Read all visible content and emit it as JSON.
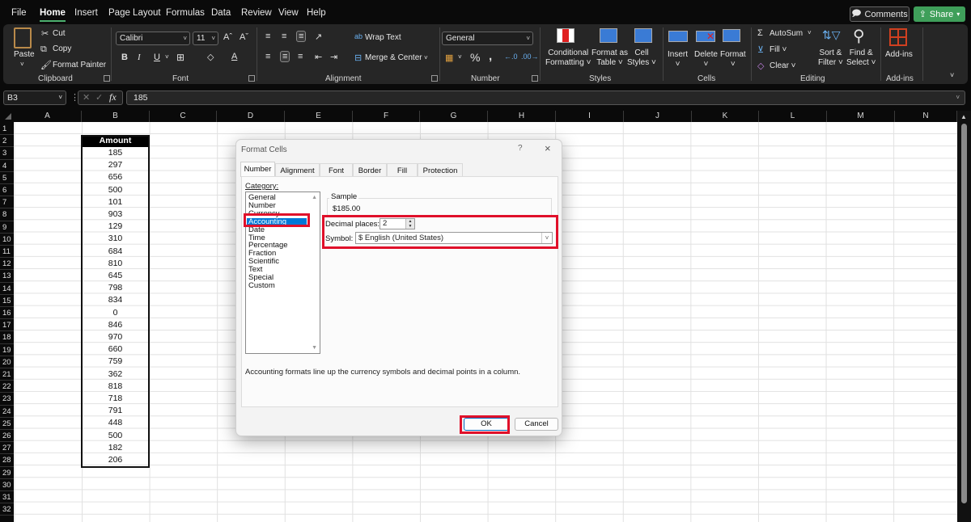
{
  "menu": {
    "items": [
      "File",
      "Home",
      "Insert",
      "Page Layout",
      "Formulas",
      "Data",
      "Review",
      "View",
      "Help"
    ],
    "active": "Home",
    "comments_label": "Comments",
    "share_label": "Share"
  },
  "ribbon": {
    "clipboard": {
      "paste": "Paste",
      "cut": "Cut",
      "copy": "Copy",
      "format_painter": "Format Painter",
      "label": "Clipboard"
    },
    "font": {
      "name": "Calibri",
      "size": "11",
      "bold": "B",
      "italic": "I",
      "underline": "U",
      "label": "Font"
    },
    "alignment": {
      "wrap_text": "Wrap Text",
      "merge_center": "Merge & Center",
      "label": "Alignment"
    },
    "number": {
      "format": "General",
      "percent": "%",
      "comma": ",",
      "label": "Number"
    },
    "styles": {
      "conditional": "Conditional",
      "conditional2": "Formatting",
      "format_table": "Format as",
      "format_table2": "Table",
      "cell_styles": "Cell",
      "cell_styles2": "Styles",
      "label": "Styles"
    },
    "cells": {
      "insert": "Insert",
      "delete": "Delete",
      "format": "Format",
      "label": "Cells"
    },
    "editing": {
      "autosum": "AutoSum",
      "fill": "Fill",
      "clear": "Clear",
      "sort": "Sort &",
      "sort2": "Filter",
      "find": "Find &",
      "find2": "Select",
      "label": "Editing"
    },
    "addins": {
      "button": "Add-ins",
      "label": "Add-ins"
    }
  },
  "formula_bar": {
    "name_box": "B3",
    "fx": "fx",
    "content": "185"
  },
  "columns": [
    "A",
    "B",
    "C",
    "D",
    "E",
    "F",
    "G",
    "H",
    "I",
    "J",
    "K",
    "L",
    "M",
    "N"
  ],
  "rows": [
    "1",
    "2",
    "3",
    "4",
    "5",
    "6",
    "7",
    "8",
    "9",
    "10",
    "11",
    "12",
    "13",
    "14",
    "15",
    "16",
    "17",
    "18",
    "19",
    "20",
    "21",
    "22",
    "23",
    "24",
    "25",
    "26",
    "27",
    "28",
    "29",
    "30",
    "31",
    "32"
  ],
  "table": {
    "header": "Amount",
    "values": [
      "185",
      "297",
      "656",
      "500",
      "101",
      "903",
      "129",
      "310",
      "684",
      "810",
      "645",
      "798",
      "834",
      "0",
      "846",
      "970",
      "660",
      "759",
      "362",
      "818",
      "718",
      "791",
      "448",
      "500",
      "182",
      "206"
    ]
  },
  "dialog": {
    "title": "Format Cells",
    "help": "?",
    "close": "×",
    "tabs": [
      "Number",
      "Alignment",
      "Font",
      "Border",
      "Fill",
      "Protection"
    ],
    "active_tab": "Number",
    "category_label": "Category:",
    "categories": [
      "General",
      "Number",
      "Currency",
      "Accounting",
      "Date",
      "Time",
      "Percentage",
      "Fraction",
      "Scientific",
      "Text",
      "Special",
      "Custom"
    ],
    "selected_category": "Accounting",
    "sample_label": "Sample",
    "sample_value": "$185.00",
    "decimal_label": "Decimal places:",
    "decimal_value": "2",
    "symbol_label": "Symbol:",
    "symbol_value": "$ English (United States)",
    "description": "Accounting formats line up the currency symbols and decimal points in a column.",
    "ok_label": "OK",
    "cancel_label": "Cancel"
  },
  "colors": {
    "highlight": "#e0102a",
    "selection": "#0078d7",
    "share": "#3f9f5a"
  }
}
